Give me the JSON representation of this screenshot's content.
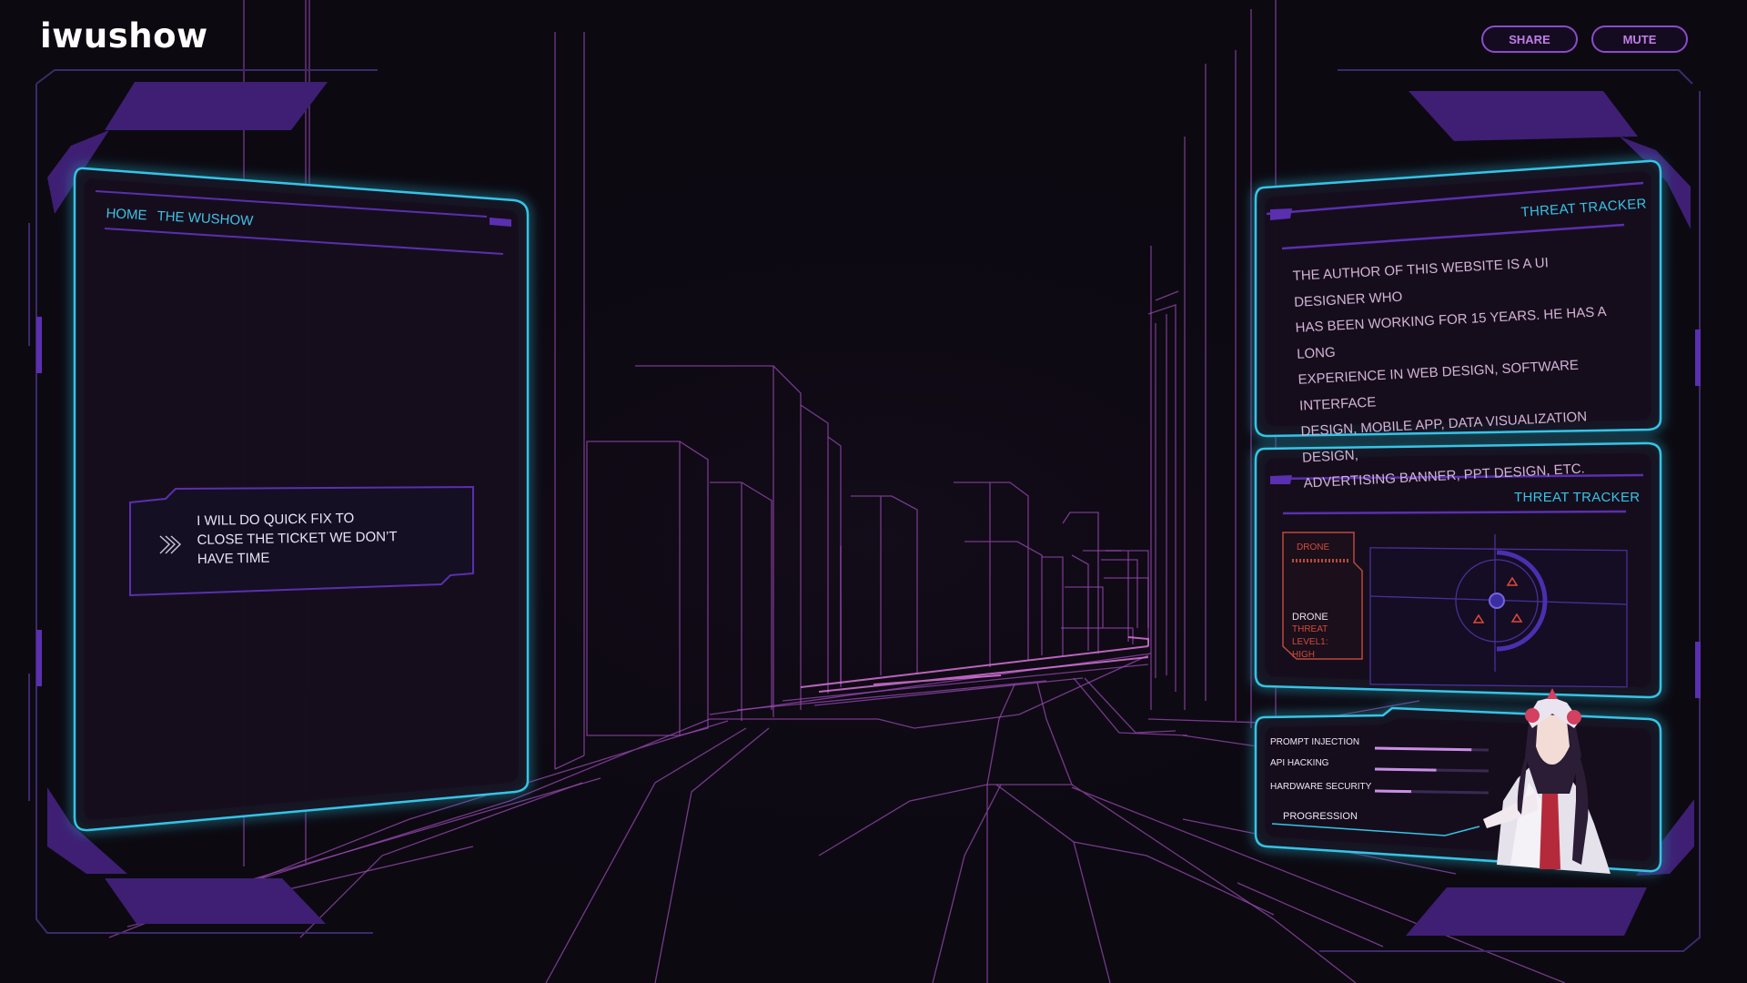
{
  "brand": {
    "logo": "iwushow"
  },
  "header": {
    "share_label": "SHARE",
    "mute_label": "MUTE"
  },
  "nav": {
    "home_label": "HOME",
    "section_label": "THE WUSHOW"
  },
  "dialog": {
    "lines": [
      "I WILL DO QUICK FIX TO",
      "CLOSE THE TICKET WE DON’T",
      "HAVE TIME"
    ]
  },
  "bio_panel": {
    "title": "THREAT TRACKER",
    "lines": [
      "THE AUTHOR OF THIS WEBSITE IS A UI DESIGNER WHO",
      "HAS BEEN WORKING FOR 15 YEARS. HE HAS A LONG",
      "EXPERIENCE IN WEB DESIGN, SOFTWARE INTERFACE",
      "DESIGN, MOBILE APP, DATA VISUALIZATION DESIGN,",
      "ADVERTISING BANNER, PPT DESIGN, ETC."
    ]
  },
  "threat_panel": {
    "title": "THREAT TRACKER",
    "card_label": "DRONE",
    "target_name": "DRONE",
    "threat_level_label": "THREAT LEVEL1:",
    "threat_level_value": "HIGH"
  },
  "skills_panel": {
    "skills": [
      {
        "label": "PROMPT INJECTION",
        "level": 0.85
      },
      {
        "label": "API HACKING",
        "level": 0.54
      },
      {
        "label": "HARDWARE SECURITY",
        "level": 0.32
      }
    ],
    "progression_label": "PROGRESSION"
  },
  "colors": {
    "background": "#0c0911",
    "accent_cyan": "#35c4e6",
    "accent_purple": "#5a2fb0",
    "city_lines": "#9a4ab4",
    "threat_red": "#d14a3e"
  }
}
